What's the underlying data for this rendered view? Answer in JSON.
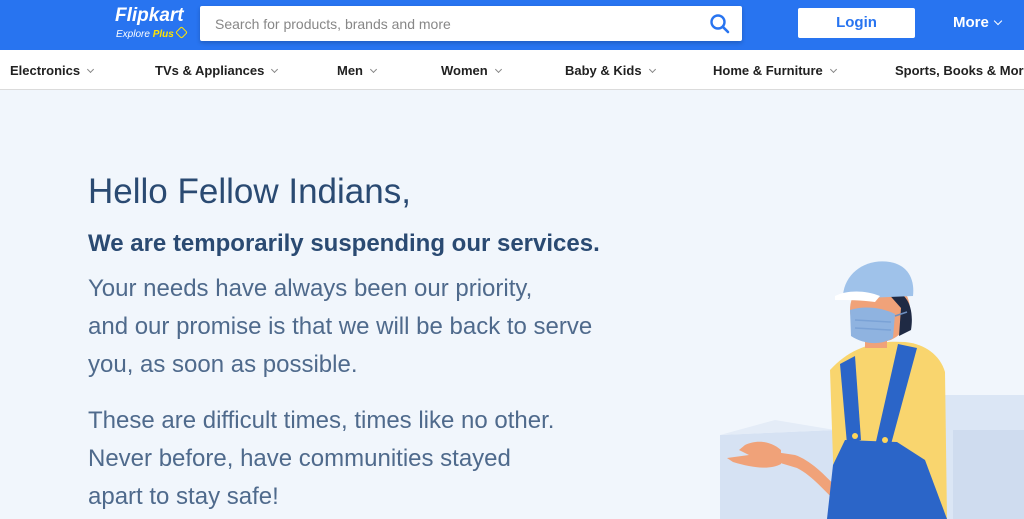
{
  "header": {
    "logo": {
      "name": "Flipkart",
      "tagline_prefix": "Explore",
      "tagline_plus": "Plus"
    },
    "search": {
      "placeholder": "Search for products, brands and more"
    },
    "login_label": "Login",
    "more_label": "More"
  },
  "categories": [
    {
      "label": "Electronics"
    },
    {
      "label": "TVs & Appliances"
    },
    {
      "label": "Men"
    },
    {
      "label": "Women"
    },
    {
      "label": "Baby & Kids"
    },
    {
      "label": "Home & Furniture"
    },
    {
      "label": "Sports, Books & More"
    }
  ],
  "message": {
    "greeting": "Hello Fellow Indians,",
    "headline": "We are temporarily suspending our services.",
    "paragraph1": [
      "Your needs have always been our priority,",
      "and our promise is that we will be back to serve",
      "you, as soon as possible."
    ],
    "paragraph2": [
      "These are difficult times, times like no other.",
      "Never before, have communities stayed",
      "apart to stay safe!"
    ]
  },
  "colors": {
    "brand_blue": "#2874f0",
    "brand_yellow": "#ffe500",
    "page_bg": "#f1f6fc",
    "heading_text": "#2a4a72",
    "body_text": "#4f6a8c"
  },
  "icons": {
    "search": "search-icon",
    "more_chevron": "chevron-down-icon",
    "category_chevron": "chevron-down-icon",
    "illustration": "masked-delivery-person-illustration"
  }
}
